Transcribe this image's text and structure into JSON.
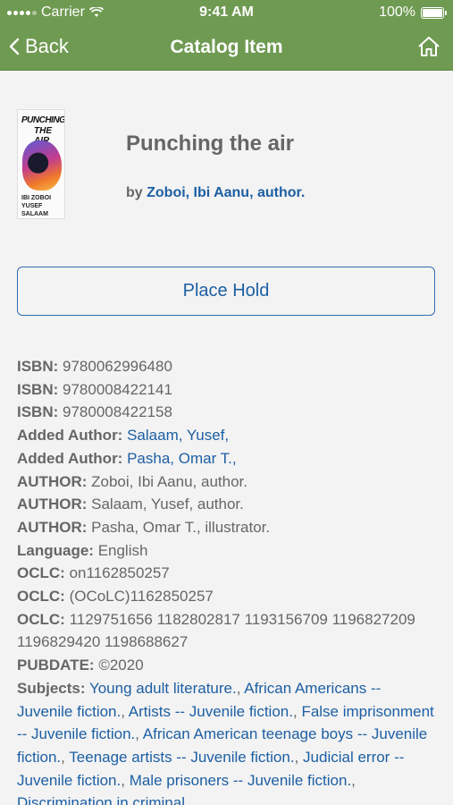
{
  "status_bar": {
    "carrier": "Carrier",
    "time": "9:41 AM",
    "battery": "100%"
  },
  "nav": {
    "back_label": "Back",
    "title": "Catalog Item"
  },
  "item": {
    "title": "Punching the air",
    "by_prefix": "by",
    "author_link": "Zoboi, Ibi Aanu, author.",
    "cover": {
      "line1": "PUNCHING",
      "line2": "THE AIR",
      "authors_line1": "IBI ZOBOI",
      "authors_line2": "YUSEF SALAAM"
    }
  },
  "place_hold_label": "Place Hold",
  "details": [
    {
      "key": "ISBN:",
      "value": "9780062996480"
    },
    {
      "key": "ISBN:",
      "value": "9780008422141"
    },
    {
      "key": "ISBN:",
      "value": "9780008422158"
    },
    {
      "key": "Added Author:",
      "link": "Salaam, Yusef,"
    },
    {
      "key": "Added Author:",
      "link": "Pasha, Omar T.,"
    },
    {
      "key": "AUTHOR:",
      "value": "Zoboi, Ibi Aanu, author."
    },
    {
      "key": "AUTHOR:",
      "value": "Salaam, Yusef, author."
    },
    {
      "key": "AUTHOR:",
      "value": "Pasha, Omar T., illustrator."
    },
    {
      "key": "Language:",
      "value": "English"
    },
    {
      "key": "OCLC:",
      "value": "on1162850257"
    },
    {
      "key": "OCLC:",
      "value": "(OCoLC)1162850257"
    },
    {
      "key": "OCLC:",
      "value": "1129751656 1182802817 1193156709 1196827209 1196829420 1198688627"
    },
    {
      "key": "PUBDATE:",
      "value": "©2020"
    }
  ],
  "subjects": {
    "key": "Subjects:",
    "items": [
      "Young adult literature.",
      "African Americans -- Juvenile fiction.",
      "Artists -- Juvenile fiction.",
      "False imprisonment -- Juvenile fiction.",
      "African American teenage boys -- Juvenile fiction.",
      "Teenage artists -- Juvenile fiction.",
      "Judicial error -- Juvenile fiction.",
      "Male prisoners -- Juvenile fiction.",
      "Discrimination in criminal"
    ]
  }
}
